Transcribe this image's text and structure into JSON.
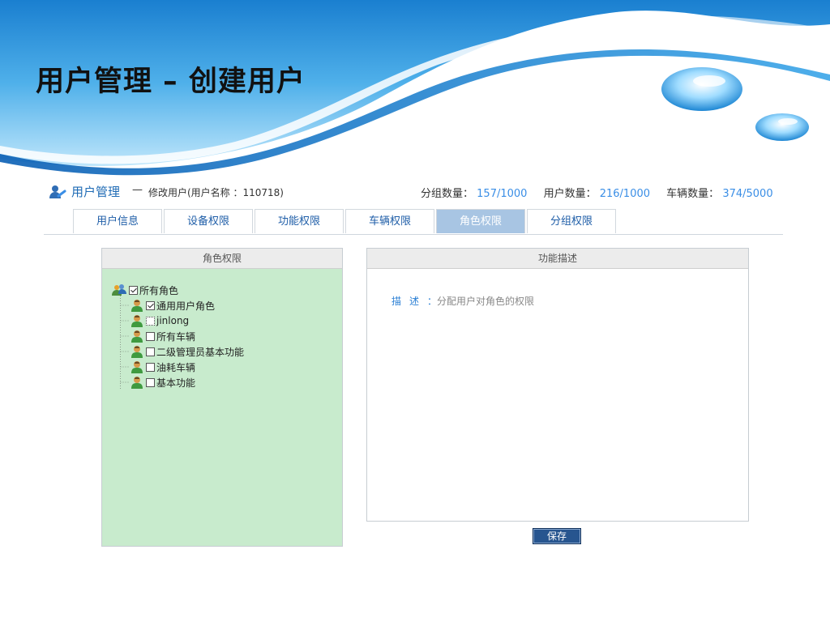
{
  "slide_title": "用户管理 – 创建用户",
  "header": {
    "module": "用户管理",
    "dash": "—",
    "edit_label": "修改用户(用户名称 ：110718)",
    "group_count_label": "分组数量：",
    "group_count": "157/1000",
    "user_count_label": "用户数量：",
    "user_count": "216/1000",
    "vehicle_count_label": "车辆数量：",
    "vehicle_count": "374/5000"
  },
  "tabs": [
    "用户信息",
    "设备权限",
    "功能权限",
    "车辆权限",
    "角色权限",
    "分组权限"
  ],
  "active_tab": "角色权限",
  "role_panel": {
    "title": "角色权限",
    "root": {
      "label": "所有角色",
      "checked": true,
      "icon": "users-group-icon"
    },
    "children": [
      {
        "label": "通用用户角色",
        "checked": true,
        "icon": "user-icon"
      },
      {
        "label": "jinlong",
        "checked": false,
        "icon": "user-icon"
      },
      {
        "label": "所有车辆",
        "checked": false,
        "icon": "user-icon"
      },
      {
        "label": "二级管理员基本功能",
        "checked": false,
        "icon": "user-icon"
      },
      {
        "label": "油耗车辆",
        "checked": false,
        "icon": "user-icon"
      },
      {
        "label": "基本功能",
        "checked": false,
        "icon": "user-icon"
      }
    ]
  },
  "desc_panel": {
    "title": "功能描述",
    "desc_label": "描述",
    "desc_colon": "：",
    "desc_text": "分配用户对角色的权限"
  },
  "save_label": "保存",
  "colors": {
    "accent_blue": "#1f6bb5",
    "count_blue": "#3a8ee6",
    "tab_active": "#a8c5e3",
    "tree_bg": "#c8ebcd",
    "button_bg": "#27558f"
  }
}
